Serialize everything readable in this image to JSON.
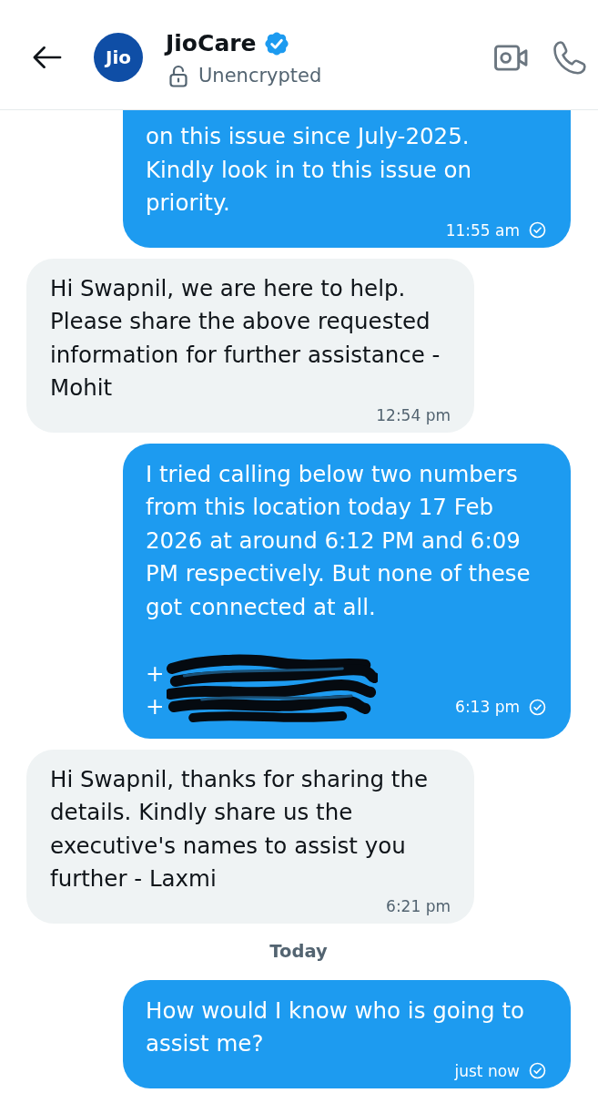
{
  "header": {
    "avatar_text": "Jio",
    "name": "JioCare",
    "verified": true,
    "status": "Unencrypted"
  },
  "messages": [
    {
      "kind": "sent",
      "clipped": true,
      "text": "on this issue since July-2025.\nKindly look in to this issue on\npriority.",
      "time": "11:55 am"
    },
    {
      "kind": "received",
      "clipped": false,
      "text": "Hi Swapnil, we are here to help.\nPlease share the above requested\ninformation for further assistance -\nMohit",
      "time": "12:54 pm"
    },
    {
      "kind": "sent",
      "clipped": false,
      "text": "I tried calling below two numbers\nfrom this location today 17 Feb\n2026 at around 6:12 PM and 6:09\nPM respectively. But none of these\ngot connected at all.",
      "redacted_lines": [
        "+",
        "+"
      ],
      "time": "6:13 pm"
    },
    {
      "kind": "received",
      "clipped": false,
      "text": "Hi Swapnil, thanks for sharing the\ndetails. Kindly share us the\nexecutive's names to assist you\nfurther - Laxmi",
      "time": "6:21 pm"
    },
    {
      "kind": "date",
      "text": "Today"
    },
    {
      "kind": "sent",
      "clipped": false,
      "text": "How would I know who is going to\nassist me?",
      "time": "just now"
    }
  ]
}
